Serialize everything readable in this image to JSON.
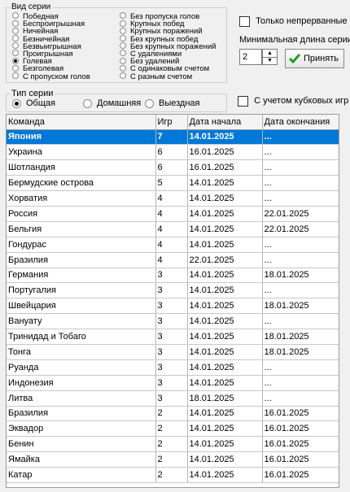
{
  "series_type_group": {
    "caption": "Вид серии",
    "col1": [
      {
        "label": "Победная",
        "selected": false
      },
      {
        "label": "Беспроигрышная",
        "selected": false
      },
      {
        "label": "Ничейная",
        "selected": false
      },
      {
        "label": "Безничейная",
        "selected": false
      },
      {
        "label": "Безвыигрышная",
        "selected": false
      },
      {
        "label": "Проигрышная",
        "selected": false
      },
      {
        "label": "Голевая",
        "selected": true
      },
      {
        "label": "Безголевая",
        "selected": false
      },
      {
        "label": "С пропуском голов",
        "selected": false
      }
    ],
    "col2": [
      {
        "label": "Без пропуска голов",
        "selected": false
      },
      {
        "label": "Крупных побед",
        "selected": false
      },
      {
        "label": "Крупных поражений",
        "selected": false
      },
      {
        "label": "Без крупных побед",
        "selected": false
      },
      {
        "label": "Без крупных поражений",
        "selected": false
      },
      {
        "label": "С удалениями",
        "selected": false
      },
      {
        "label": "Без удалений",
        "selected": false
      },
      {
        "label": "С одинаковым счетом",
        "selected": false
      },
      {
        "label": "С разным счетом",
        "selected": false
      }
    ]
  },
  "only_continuous": {
    "label": "Только непрерванные",
    "checked": false
  },
  "min_length": {
    "label": "Минимальная длина серии",
    "value": "2"
  },
  "accept_button": {
    "label": "Принять"
  },
  "series_kind_group": {
    "caption": "Тип серии",
    "options": [
      {
        "label": "Общая",
        "selected": true
      },
      {
        "label": "Домашняя",
        "selected": false
      },
      {
        "label": "Выездная",
        "selected": false
      }
    ]
  },
  "cup_games": {
    "label": "С учетом кубковых игр",
    "checked": false
  },
  "table": {
    "headers": [
      "Команда",
      "Игр",
      "Дата начала",
      "Дата окончания"
    ],
    "rows": [
      [
        "Япония",
        "7",
        "14.01.2025",
        "..."
      ],
      [
        "Украина",
        "6",
        "16.01.2025",
        "..."
      ],
      [
        "Шотландия",
        "6",
        "16.01.2025",
        "..."
      ],
      [
        "Бермудские острова",
        "5",
        "14.01.2025",
        "..."
      ],
      [
        "Хорватия",
        "4",
        "14.01.2025",
        "..."
      ],
      [
        "Россия",
        "4",
        "14.01.2025",
        "22.01.2025"
      ],
      [
        "Бельгия",
        "4",
        "14.01.2025",
        "22.01.2025"
      ],
      [
        "Гондурас",
        "4",
        "14.01.2025",
        "..."
      ],
      [
        "Бразилия",
        "4",
        "22.01.2025",
        "..."
      ],
      [
        "Германия",
        "3",
        "14.01.2025",
        "18.01.2025"
      ],
      [
        "Португалия",
        "3",
        "14.01.2025",
        "..."
      ],
      [
        "Швейцария",
        "3",
        "14.01.2025",
        "18.01.2025"
      ],
      [
        "Вануату",
        "3",
        "14.01.2025",
        "..."
      ],
      [
        "Тринидад и Тобаго",
        "3",
        "14.01.2025",
        "18.01.2025"
      ],
      [
        "Тонга",
        "3",
        "14.01.2025",
        "18.01.2025"
      ],
      [
        "Руанда",
        "3",
        "14.01.2025",
        "..."
      ],
      [
        "Индонезия",
        "3",
        "14.01.2025",
        "..."
      ],
      [
        "Литва",
        "3",
        "18.01.2025",
        "..."
      ],
      [
        "Бразилия",
        "2",
        "14.01.2025",
        "16.01.2025"
      ],
      [
        "Эквадор",
        "2",
        "14.01.2025",
        "16.01.2025"
      ],
      [
        "Бенин",
        "2",
        "14.01.2025",
        "16.01.2025"
      ],
      [
        "Ямайка",
        "2",
        "14.01.2025",
        "16.01.2025"
      ],
      [
        "Катар",
        "2",
        "14.01.2025",
        "16.01.2025"
      ]
    ],
    "selected_row": 0
  },
  "colors": {
    "selection": "#0078d7",
    "accept_icon": "#1e9e1e"
  }
}
